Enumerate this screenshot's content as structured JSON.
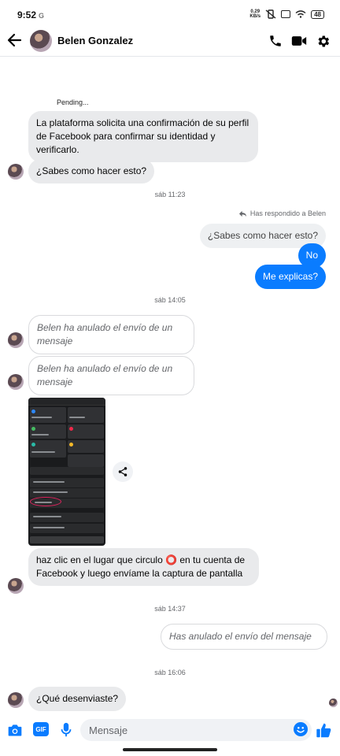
{
  "status": {
    "time": "9:52",
    "carrier": "G",
    "speed_value": "0.29",
    "speed_unit": "KB/s",
    "battery": "48"
  },
  "header": {
    "contact_name": "Belen Gonzalez",
    "icons": [
      "back-arrow-icon",
      "phone-icon",
      "video-camera-icon",
      "gear-icon"
    ]
  },
  "messages": {
    "pending_label": "Pending...",
    "m1": "La plataforma solicita una confirmación de su perfil de Facebook para confirmar su identidad y verificarlo.",
    "m2": "¿Sabes como hacer esto?",
    "ts1": "sáb 11:23",
    "replied_label": "Has respondido a Belen",
    "quoted": "¿Sabes como hacer esto?",
    "out1": "No",
    "out2": "Me explicas?",
    "ts2": "sáb 14:05",
    "unsent1": "Belen ha anulado el envío de un mensaje",
    "unsent2": "Belen ha anulado el envío de un mensaje",
    "m3": "haz clic en el lugar que circulo ⭕ en tu cuenta de Facebook y luego envíame la captura de pantalla",
    "ts3": "sáb 14:37",
    "unsent_self": "Has anulado el envío del mensaje",
    "ts4": "sáb 16:06",
    "m4": "¿Qué desenviaste?"
  },
  "composer": {
    "placeholder": "Mensaje",
    "gif_label": "GIF",
    "icons": [
      "camera-icon",
      "gif-icon",
      "microphone-icon",
      "emoji-icon",
      "thumbs-up-icon"
    ]
  },
  "colors": {
    "accent": "#0a7cff",
    "incoming_bubble": "#e9eaec",
    "timestamp": "#65676b"
  }
}
